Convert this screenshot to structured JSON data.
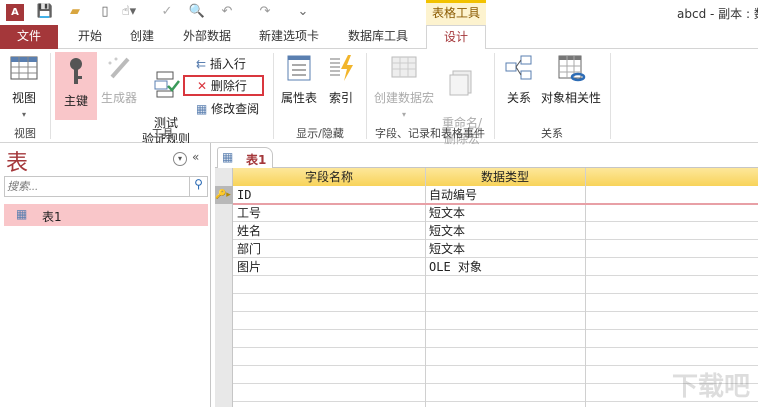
{
  "titlebar": {
    "title": "abcd - 副本 : 数",
    "context_tab": "表格工具"
  },
  "tabs": [
    "文件",
    "开始",
    "创建",
    "外部数据",
    "新建选项卡",
    "数据库工具",
    "设计"
  ],
  "ribbon": {
    "view": {
      "label": "视图",
      "group": "视图"
    },
    "tools": {
      "primary_key": "主键",
      "builder": "生成器",
      "test_rules": "测试\n验证规则",
      "insert_row": "插入行",
      "delete_row": "删除行",
      "modify_lookup": "修改查阅",
      "group": "工具"
    },
    "show_hide": {
      "property_sheet": "属性表",
      "indexes": "索引",
      "group": "显示/隐藏"
    },
    "events": {
      "create_macro": "创建数据宏",
      "rename_macro": "重命名/\n删除宏",
      "group": "字段、记录和表格事件"
    },
    "relationships": {
      "relationships": "关系",
      "dependencies": "对象相关性",
      "group": "关系"
    }
  },
  "nav": {
    "title": "表",
    "search_placeholder": "搜索...",
    "items": [
      {
        "label": "表1"
      }
    ]
  },
  "doc": {
    "tab": "表1",
    "columns": [
      "字段名称",
      "数据类型"
    ],
    "rows": [
      {
        "name": "ID",
        "type": "自动编号"
      },
      {
        "name": "工号",
        "type": "短文本"
      },
      {
        "name": "姓名",
        "type": "短文本"
      },
      {
        "name": "部门",
        "type": "短文本"
      },
      {
        "name": "图片",
        "type": "OLE 对象"
      }
    ]
  }
}
